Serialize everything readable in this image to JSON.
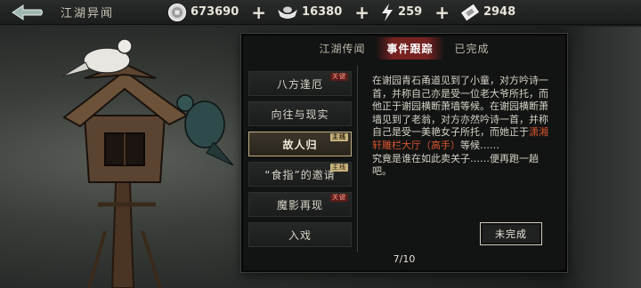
{
  "header": {
    "title": "江湖异闻",
    "resources": [
      {
        "icon": "coin-icon",
        "value": "673690"
      },
      {
        "icon": "ingot-icon",
        "value": "16380"
      },
      {
        "icon": "lightning-icon",
        "value": "259"
      },
      {
        "icon": "ticket-icon",
        "value": "2948"
      }
    ]
  },
  "tabs": [
    {
      "label": "江湖传闻",
      "active": false
    },
    {
      "label": "事件跟踪",
      "active": true
    },
    {
      "label": "已完成",
      "active": false
    }
  ],
  "events": [
    {
      "label": "八方逢厄",
      "tag": "关键"
    },
    {
      "label": "向往与现实",
      "tag": ""
    },
    {
      "label": "故人归",
      "tag": "主线"
    },
    {
      "label": "“食指”的邀请",
      "tag": "主线"
    },
    {
      "label": "魔影再现",
      "tag": "关键"
    },
    {
      "label": "入戏",
      "tag": ""
    }
  ],
  "selected_index": 2,
  "description": {
    "part1": "在谢园青石甬道见到了小童，对方吟诗一首，并称自己亦是受一位老大爷所托，而他正于谢园横断萧墙等候。在谢园横断萧墙见到了老翁，对方亦然吟诗一首，并称自己是受一美艳女子所托，而她正于",
    "highlight": "潇湘轩雕栏大厅（高手）",
    "part2": "等候……",
    "part3": "究竟是谁在如此卖关子……便再跑一趟吧。"
  },
  "status_button": "未完成",
  "pager": "7/10",
  "colors": {
    "highlight": "#d9542f",
    "selected_border": "#bfae86"
  }
}
